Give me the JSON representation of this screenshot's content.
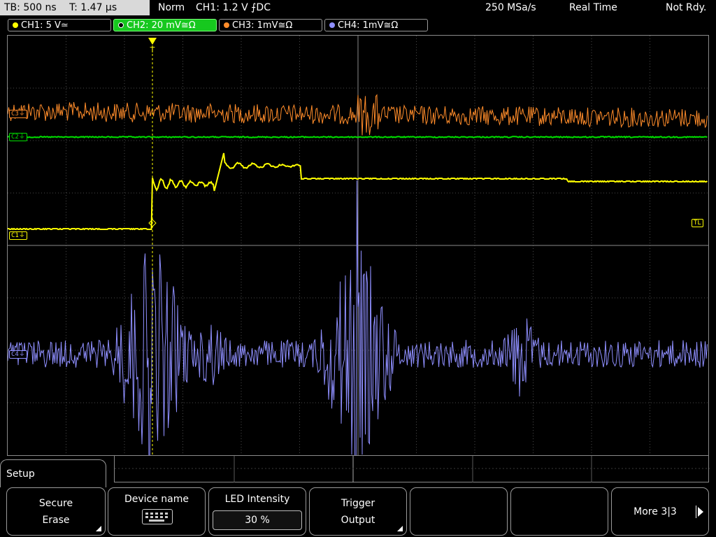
{
  "status": {
    "timebase": "TB: 500 ns",
    "trigger_time": "T: 1.47 µs",
    "mode": "Norm",
    "trigger_info": "CH1: 1.2 V ⨍DC",
    "sample_rate": "250 MSa/s",
    "acq_mode": "Real Time",
    "state": "Not Rdy."
  },
  "channels": [
    {
      "label": "CH1: 5 V≃",
      "color": "#ffff00",
      "active": false
    },
    {
      "label": "CH2: 20 mV≅Ω",
      "color": "#00ff00",
      "active": true
    },
    {
      "label": "CH3: 1mV≅Ω",
      "color": "#ff8c2a",
      "active": false
    },
    {
      "label": "CH4: 1mV≅Ω",
      "color": "#8f8fff",
      "active": false
    }
  ],
  "markers": {
    "trigger": "T",
    "trigger_level": "TL",
    "ch1_ref": "C1⏚",
    "ch2_ref": "C2⏚",
    "ch3_ref": "C3⏚",
    "ch4_ref": "C4⏚"
  },
  "menu": {
    "title": "Setup",
    "keys": [
      {
        "line1": "Secure",
        "line2": "Erase"
      },
      {
        "line1": "Device name"
      },
      {
        "line1": "LED Intensity",
        "value": "30 %"
      },
      {
        "line1": "Trigger",
        "line2": "Output"
      },
      {
        "line1": ""
      },
      {
        "line1": ""
      },
      {
        "line1": "More 3|3"
      }
    ]
  },
  "colors": {
    "ch1": "#ffff00",
    "ch2": "#00e000",
    "ch3": "#ff8c2a",
    "ch4": "#8f8fff",
    "grid": "#5a5a5a"
  }
}
